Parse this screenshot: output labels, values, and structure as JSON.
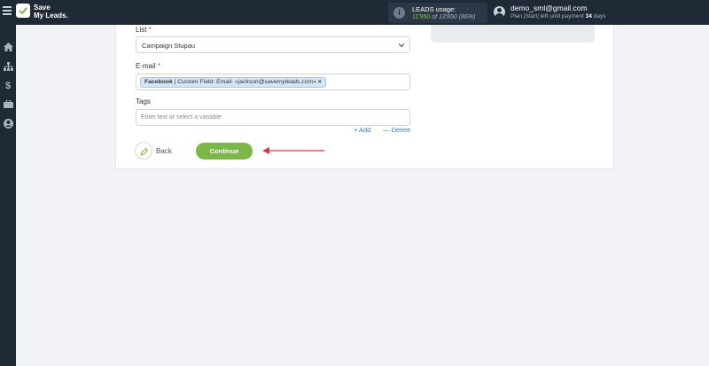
{
  "header": {
    "brand_line1": "Save",
    "brand_line2": "My Leads.",
    "usage_title": "LEADS usage:",
    "usage_used": "11'950",
    "usage_rest": " of 13'850 (86%)",
    "user_email": "demo_sml@gmail.com",
    "plan_prefix": "Plan |Start| left until payment ",
    "plan_days": "34",
    "plan_suffix": " days"
  },
  "sidebar": {
    "icons": [
      "home-icon",
      "sitemap-icon",
      "dollar-icon",
      "briefcase-icon",
      "user-icon"
    ]
  },
  "form": {
    "list_label": "List",
    "list_value": "Campaign Stupau",
    "email_label": "E-mail",
    "email_tag_source": "Facebook",
    "email_tag_mid": " | Custom Field: Email: ",
    "email_tag_value": "«jackson@savemyleads.com»",
    "email_tag_remove": "×",
    "tags_label": "Tags",
    "tags_placeholder": "Enter text or select a variable",
    "add_label": "+ Add",
    "delete_label": "— Delete",
    "required_mark": "*"
  },
  "actions": {
    "back_label": "Back",
    "continue_label": "Continue"
  },
  "colors": {
    "accent_green": "#7ab648",
    "arrow_red": "#d9363e",
    "link_blue": "#3a7bbf"
  }
}
